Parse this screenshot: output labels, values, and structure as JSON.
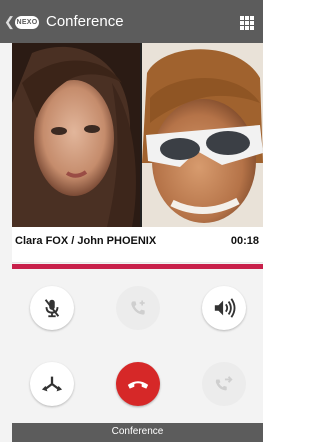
{
  "header": {
    "back_icon": "chevron-left-icon",
    "logo_text": "NEXO",
    "title": "Conference",
    "menu_icon": "grid-icon"
  },
  "video": {
    "participants": [
      {
        "name": "Clara FOX",
        "view": "left"
      },
      {
        "name": "John PHOENIX",
        "view": "right"
      }
    ]
  },
  "call": {
    "names": "Clara FOX / John PHOENIX",
    "timer": "00:18",
    "accent_color": "#c8204a"
  },
  "controls": [
    {
      "icon": "mic-muted-icon",
      "state": "enabled"
    },
    {
      "icon": "add-call-icon",
      "state": "disabled"
    },
    {
      "icon": "speaker-icon",
      "state": "enabled"
    },
    {
      "icon": "merge-calls-icon",
      "state": "enabled"
    },
    {
      "icon": "hangup-icon",
      "state": "enabled",
      "color": "#d62828"
    },
    {
      "icon": "transfer-icon",
      "state": "disabled"
    }
  ],
  "footer": {
    "label": "Conference"
  }
}
